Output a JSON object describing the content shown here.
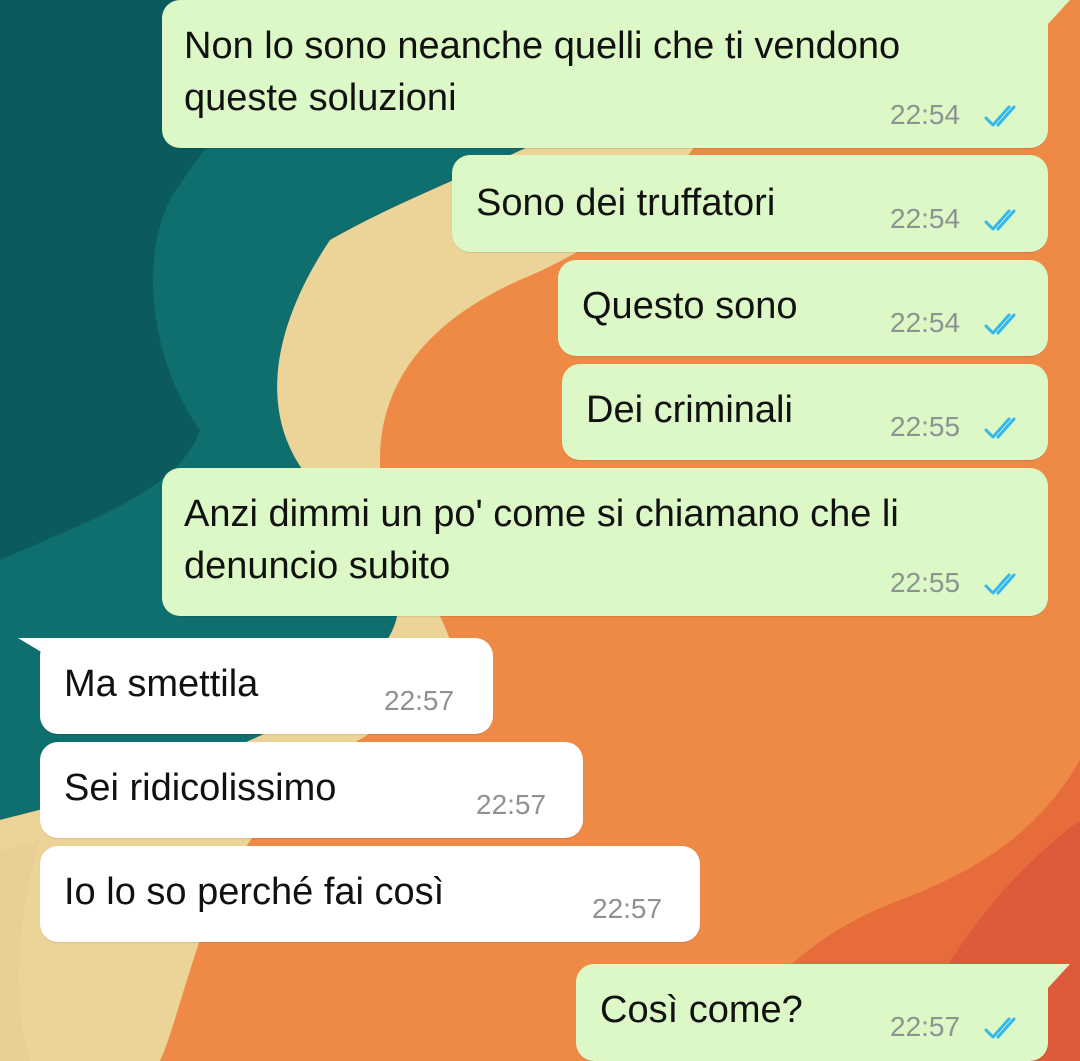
{
  "colors": {
    "outgoing_bubble": "#dcf8c6",
    "incoming_bubble": "#ffffff",
    "read_ticks": "#34b7f1",
    "timestamp": "#8c9391"
  },
  "read_receipt_icon": "double-check-icon",
  "messages": [
    {
      "direction": "outgoing",
      "lines": [
        "Non lo sono neanche quelli che ti vendono",
        "queste soluzioni"
      ],
      "time": "22:54",
      "read": true
    },
    {
      "direction": "outgoing",
      "lines": [
        "Sono dei truffatori"
      ],
      "time": "22:54",
      "read": true
    },
    {
      "direction": "outgoing",
      "lines": [
        "Questo sono"
      ],
      "time": "22:54",
      "read": true
    },
    {
      "direction": "outgoing",
      "lines": [
        "Dei criminali"
      ],
      "time": "22:55",
      "read": true
    },
    {
      "direction": "outgoing",
      "lines": [
        "Anzi dimmi un po' come si chiamano che li",
        "denuncio subito"
      ],
      "time": "22:55",
      "read": true
    },
    {
      "direction": "incoming",
      "lines": [
        "Ma smettila"
      ],
      "time": "22:57"
    },
    {
      "direction": "incoming",
      "lines": [
        "Sei ridicolissimo"
      ],
      "time": "22:57"
    },
    {
      "direction": "incoming",
      "lines": [
        "Io lo so perché fai così"
      ],
      "time": "22:57"
    },
    {
      "direction": "outgoing",
      "lines": [
        "Così come?"
      ],
      "time": "22:57",
      "read": true
    }
  ]
}
